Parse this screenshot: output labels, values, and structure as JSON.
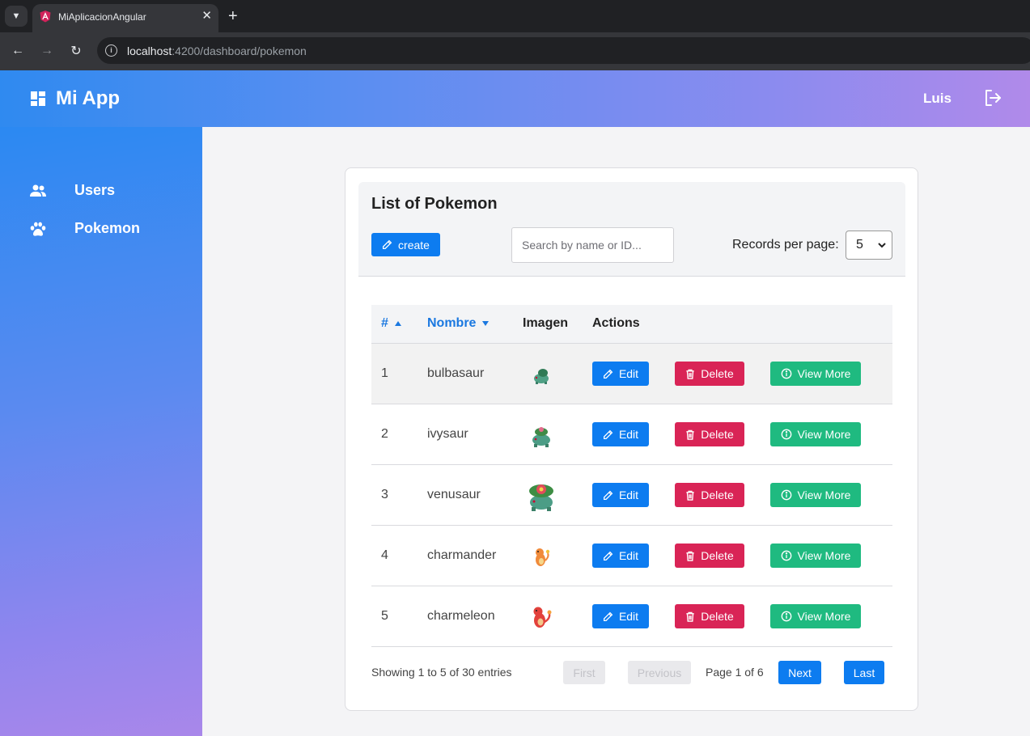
{
  "browser": {
    "tab_title": "MiAplicacionAngular",
    "url_host": "localhost",
    "url_rest": ":4200/dashboard/pokemon"
  },
  "header": {
    "brand": "Mi App",
    "username": "Luis"
  },
  "sidebar": {
    "items": [
      {
        "label": "Users",
        "icon": "users-icon"
      },
      {
        "label": "Pokemon",
        "icon": "paw-icon"
      }
    ]
  },
  "card": {
    "title": "List of Pokemon",
    "create_label": "create",
    "search_placeholder": "Search by name or ID...",
    "rpp_label": "Records per page:",
    "rpp_value": "5"
  },
  "table": {
    "headers": {
      "id": "#",
      "name": "Nombre",
      "image": "Imagen",
      "actions": "Actions"
    },
    "rows": [
      {
        "id": "1",
        "name": "bulbasaur"
      },
      {
        "id": "2",
        "name": "ivysaur"
      },
      {
        "id": "3",
        "name": "venusaur"
      },
      {
        "id": "4",
        "name": "charmander"
      },
      {
        "id": "5",
        "name": "charmeleon"
      }
    ],
    "edit_label": "Edit",
    "delete_label": "Delete",
    "view_label": "View More"
  },
  "pagination": {
    "info": "Showing 1 to 5 of 30 entries",
    "first": "First",
    "previous": "Previous",
    "page_text": "Page 1 of 6",
    "next": "Next",
    "last": "Last"
  },
  "colors": {
    "primary": "#0d7cf0",
    "danger": "#d92456",
    "success": "#1fba80"
  }
}
